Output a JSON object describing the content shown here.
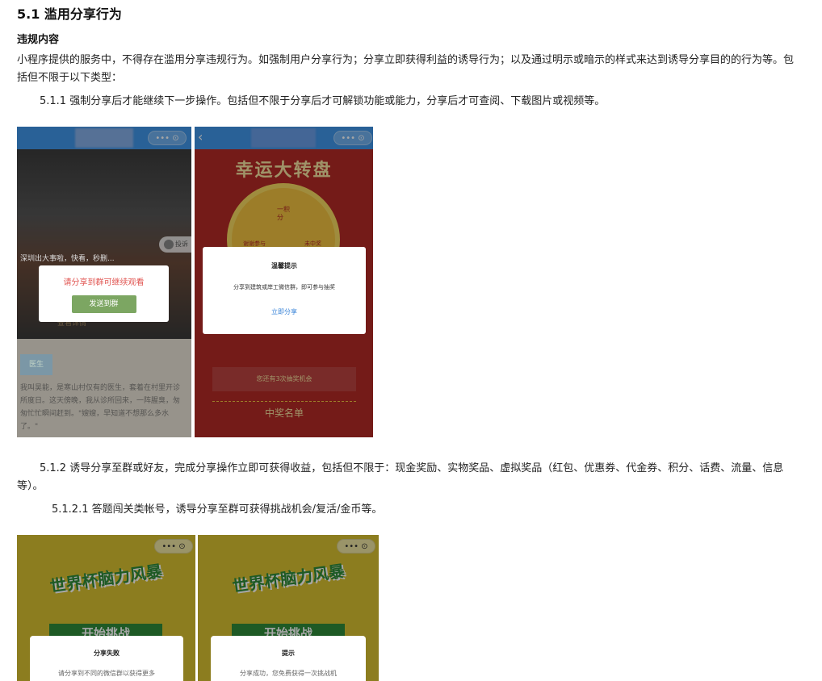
{
  "heading": "5.1 滥用分享行为",
  "subheading": "违规内容",
  "intro": "小程序提供的服务中，不得存在滥用分享违规行为。如强制用户分享行为；分享立即获得利益的诱导行为；以及通过明示或暗示的样式来达到诱导分享目的的行为等。包括但不限于以下类型：",
  "item_511": "5.1.1 强制分享后才能继续下一步操作。包括但不限于分享后才可解锁功能或能力，分享后才可查阅、下载图片或视频等。",
  "item_512": "5.1.2 诱导分享至群或好友，完成分享操作立即可获得收益，包括但不限于：现金奖励、实物奖品、虚拟奖品（红包、优惠券、代金券、积分、话费、流量、信息等）。",
  "item_5121": "5.1.2.1 答题闯关类帐号，诱导分享至群可获得挑战机会/复活/金币等。",
  "shot1": {
    "capsule": "•••  ⊙",
    "report": "投诉",
    "news_caption": "深圳出大事啦，快看，秒删...",
    "dialog_title": "请分享到群可继续观看",
    "dialog_button": "发送到群",
    "more_btn": "查看详情",
    "tag": "医生",
    "body_text": "我叫吴能，是寒山村仅有的医生，套着在村里开诊所度日。这天傍晚，我从诊所回来，一阵腥臭，匆匆忙忙瞬间赶到。\"嫂嫂，早知道不想那么多水了。\""
  },
  "shot2": {
    "back": "‹",
    "capsule": "•••  ⊙",
    "title": "幸运大转盘",
    "wheel_label1": "一积分",
    "wheel_label2": "谢谢参与",
    "wheel_label3": "未中奖",
    "dialog_title": "温馨提示",
    "dialog_text": "分享到建筑或岸工微信群，即可参与抽奖",
    "dialog_link": "立即分享",
    "chances": "您还有3次抽奖机会",
    "winners": "中奖名单"
  },
  "shot3": {
    "capsule": "•••  ⊙",
    "banner": "世界杯脑力风暴",
    "start": "开始挑战",
    "dialog_title": "分享失败",
    "dialog_text": "请分享到不同的微信群以获得更多"
  },
  "shot4": {
    "capsule": "•••  ⊙",
    "banner": "世界杯脑力风暴",
    "start": "开始挑战",
    "dialog_title": "提示",
    "dialog_text": "分享成功，您免费获得一次挑战机"
  },
  "colors": {
    "wechat_blue": "#3f95e8",
    "share_red": "#e0534f",
    "share_green": "#7ca662",
    "wheel_red": "#b22a26",
    "link_blue": "#3a84d8",
    "quiz_yellow": "#d8c030",
    "quiz_green": "#2e8a3a"
  }
}
